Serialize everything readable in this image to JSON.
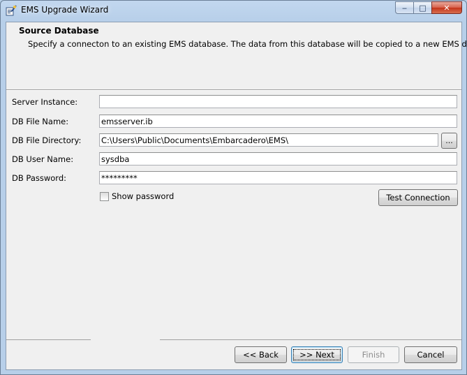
{
  "window": {
    "title": "EMS Upgrade Wizard",
    "icon": "wizard-app-icon",
    "minimize_glyph": "‒",
    "maximize_glyph": "□",
    "close_glyph": "✕"
  },
  "header": {
    "title": "Source Database",
    "description": "Specify a connecton to an existing EMS database.  The data from this database will be copied to a new EMS database"
  },
  "form": {
    "server_instance": {
      "label": "Server Instance:",
      "value": ""
    },
    "db_file_name": {
      "label": "DB File Name:",
      "value": "emsserver.ib"
    },
    "db_file_directory": {
      "label": "DB File Directory:",
      "value": "C:\\Users\\Public\\Documents\\Embarcadero\\EMS\\",
      "browse_label": "..."
    },
    "db_user_name": {
      "label": "DB User Name:",
      "value": "sysdba"
    },
    "db_password": {
      "label": "DB Password:",
      "value": "*********"
    },
    "show_password": {
      "label": "Show password",
      "checked": false
    },
    "test_connection_label": "Test Connection"
  },
  "footer": {
    "back_label": "<< Back",
    "next_label": ">> Next",
    "finish_label": "Finish",
    "cancel_label": "Cancel"
  },
  "colors": {
    "title_bar": "#b7cfe9",
    "client_bg": "#f0f0f0",
    "close_button": "#c4341b",
    "default_button_border": "#3c7fb1"
  }
}
